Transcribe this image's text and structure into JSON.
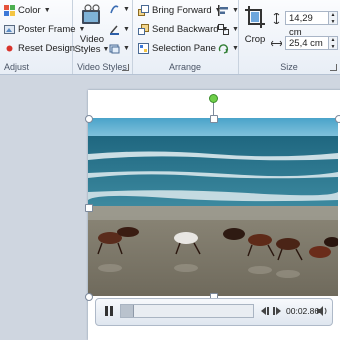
{
  "ribbon": {
    "adjust": {
      "color_label": "Color",
      "poster_frame_label": "Poster Frame",
      "reset_design_label": "Reset Design",
      "group_label": "Adjust"
    },
    "video_styles": {
      "video_styles_label_line1": "Video",
      "video_styles_label_line2": "Styles",
      "group_label": "Video Styles"
    },
    "arrange": {
      "bring_forward_label": "Bring Forward",
      "send_backward_label": "Send Backward",
      "selection_pane_label": "Selection Pane",
      "group_label": "Arrange"
    },
    "size": {
      "crop_label": "Crop",
      "height_value": "14,29 cm",
      "width_value": "25,4 cm",
      "group_label": "Size"
    }
  },
  "player": {
    "time": "00:02.86"
  },
  "colors": {
    "rotation_handle": "#6fcf4a",
    "ribbon_bg": "#e8eef6",
    "sea": "#2d6f86",
    "sky": "#5aa9c8"
  }
}
